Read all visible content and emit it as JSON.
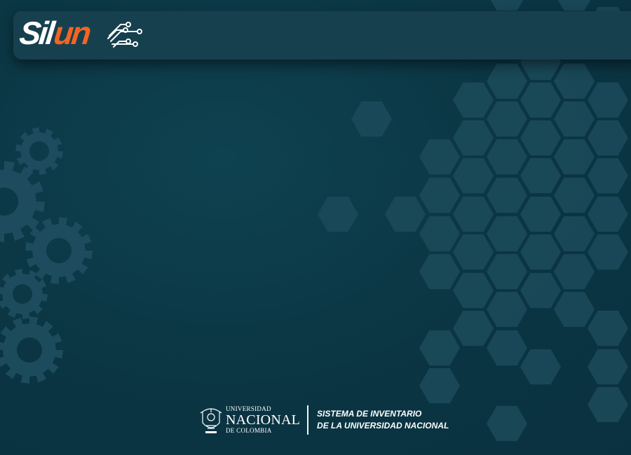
{
  "app": {
    "logo_part1": "Sil",
    "logo_part2": "un",
    "logo_color_primary": "#ffffff",
    "logo_color_accent": "#f26522"
  },
  "footer": {
    "university_line1": "UNIVERSIDAD",
    "university_line2": "NACIONAL",
    "university_line3": "DE COLOMBIA",
    "system_line1": "SISTEMA DE INVENTARIO",
    "system_line2": "DE LA UNIVERSIDAD NACIONAL"
  },
  "colors": {
    "background": "#0d3a49",
    "header_bar": "#17404f",
    "hexagon": "#1c4b5a",
    "gear": "#1e4f5f"
  }
}
